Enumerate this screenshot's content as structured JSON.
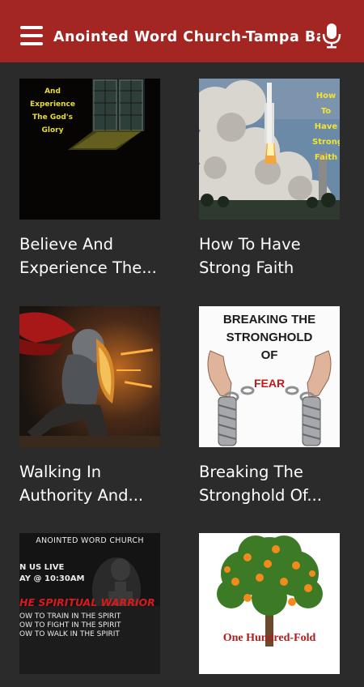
{
  "header": {
    "title": "Anointed Word Church-Tampa Ba",
    "menu_icon": "hamburger-menu-icon",
    "mic_icon": "microphone-icon",
    "bar_color": "#a42622"
  },
  "cards": [
    {
      "title": "Believe And\nExperience The...",
      "thumb_text": "And\nExperience\nThe God's\nGlory"
    },
    {
      "title": "How To Have\nStrong Faith",
      "thumb_text": "How\nTo\nHave\nStrong\nFaith"
    },
    {
      "title": "Walking In\nAuthority And...",
      "thumb_text": ""
    },
    {
      "title": "Breaking The\nStronghold Of...",
      "thumb_text_top": "BREAKING THE\nSTRONGHOLD\nOF",
      "thumb_text_accent": "FEAR"
    },
    {
      "title": "",
      "thumb_text_top": "ANOINTED WORD CHURCH",
      "thumb_text_live": "N US LIVE\nAY @ 10:30AM",
      "thumb_text_accent": "HE SPIRITUAL WARRIOR",
      "thumb_text_lines": "OW TO TRAIN IN THE SPIRIT\nOW TO FIGHT IN THE SPIRIT\nOW TO WALK IN THE SPIRIT"
    },
    {
      "title": "",
      "thumb_text": "One Hundred-Fold"
    }
  ]
}
